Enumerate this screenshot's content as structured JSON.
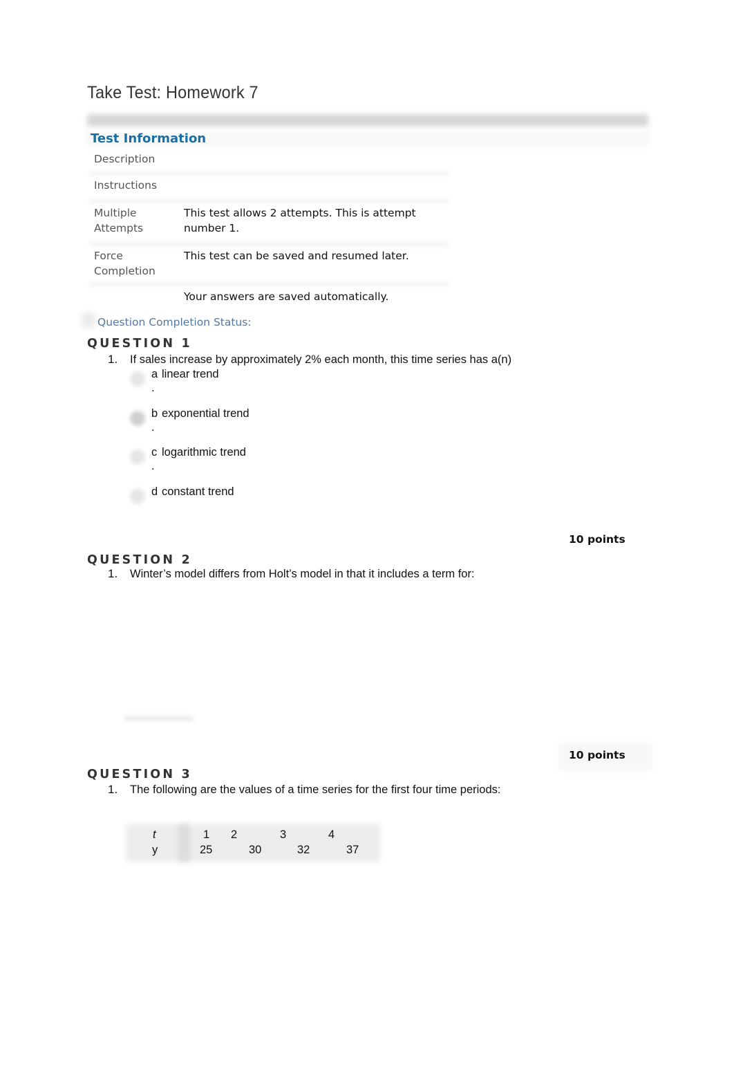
{
  "page": {
    "title": "Take Test: Homework 7"
  },
  "test_information": {
    "heading": "Test Information",
    "rows": [
      {
        "label": "Description",
        "value": ""
      },
      {
        "label": "Instructions",
        "value": ""
      },
      {
        "label_line1": "Multiple",
        "label_line2": "Attempts",
        "value_line1": "This test allows 2 attempts. This is attempt",
        "value_line2": "number 1."
      },
      {
        "label_line1": "Force",
        "label_line2": "Completion",
        "value": "This test can be saved and resumed later."
      },
      {
        "label": "",
        "value": "Your answers are saved automatically."
      }
    ]
  },
  "completion_status": {
    "label": "Question Completion Status:"
  },
  "questions": [
    {
      "header": "QUESTION 1",
      "number": "1.",
      "text": "If sales increase by approximately 2% each month, this time series has a(n)",
      "options": [
        {
          "letter": "a",
          "text": "linear trend",
          "dot": ".",
          "selected": false
        },
        {
          "letter": "b",
          "text": "exponential trend",
          "dot": ".",
          "selected": true
        },
        {
          "letter": "c",
          "text": "logarithmic trend",
          "dot": ".",
          "selected": false
        },
        {
          "letter": "d",
          "text": "constant trend",
          "dot": "",
          "selected": false
        }
      ],
      "points": "10 points"
    },
    {
      "header": "QUESTION 2",
      "number": "1.",
      "text": "Winter’s model differs from Holt’s model in that it includes a term for:",
      "points": "10 points"
    },
    {
      "header": "QUESTION 3",
      "number": "1.",
      "text": "The following are the values of a time series for the first four time periods:",
      "table": {
        "row_t": {
          "label": "t",
          "values": [
            "1",
            "2",
            "3",
            "4"
          ]
        },
        "row_y": {
          "label": "y",
          "values": [
            "25",
            "30",
            "32",
            "37"
          ]
        }
      }
    }
  ]
}
